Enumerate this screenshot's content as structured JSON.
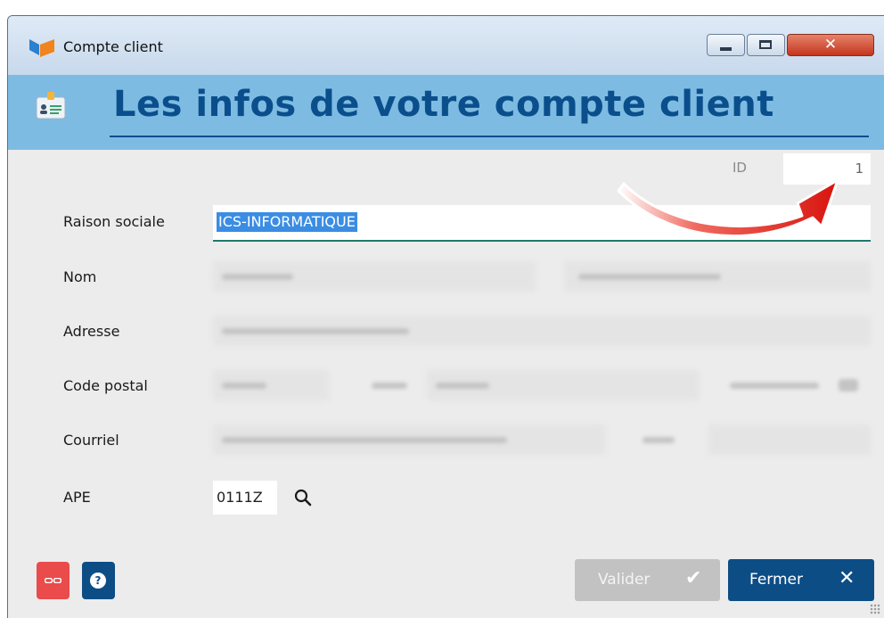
{
  "window": {
    "title": "Compte client",
    "controls": [
      "minimize",
      "maximize",
      "close"
    ]
  },
  "banner": {
    "title": "Les infos de votre compte client"
  },
  "form": {
    "id": {
      "label": "ID",
      "value": "1"
    },
    "raison_sociale": {
      "label": "Raison sociale",
      "value": "ICS-INFORMATIQUE"
    },
    "nom": {
      "label": "Nom"
    },
    "adresse": {
      "label": "Adresse"
    },
    "code_postal": {
      "label": "Code postal"
    },
    "courriel": {
      "label": "Courriel"
    },
    "ape": {
      "label": "APE",
      "value": "0111Z"
    }
  },
  "buttons": {
    "valider": "Valider",
    "fermer": "Fermer"
  },
  "colors": {
    "banner": "#7ebbe2",
    "title": "#0a4f8c",
    "primary_button": "#0d4d86",
    "danger_button": "#ea4b4b",
    "disabled_button": "#c2c2c2",
    "selection": "#3b8de3",
    "annotation_arrow": "#e8231d"
  },
  "icons": {
    "app": "app-logo-icon",
    "banner": "contact-card-icon",
    "search": "search-icon",
    "unlink": "unlink-icon",
    "help": "help-icon",
    "check": "check-icon",
    "close": "close-icon"
  }
}
